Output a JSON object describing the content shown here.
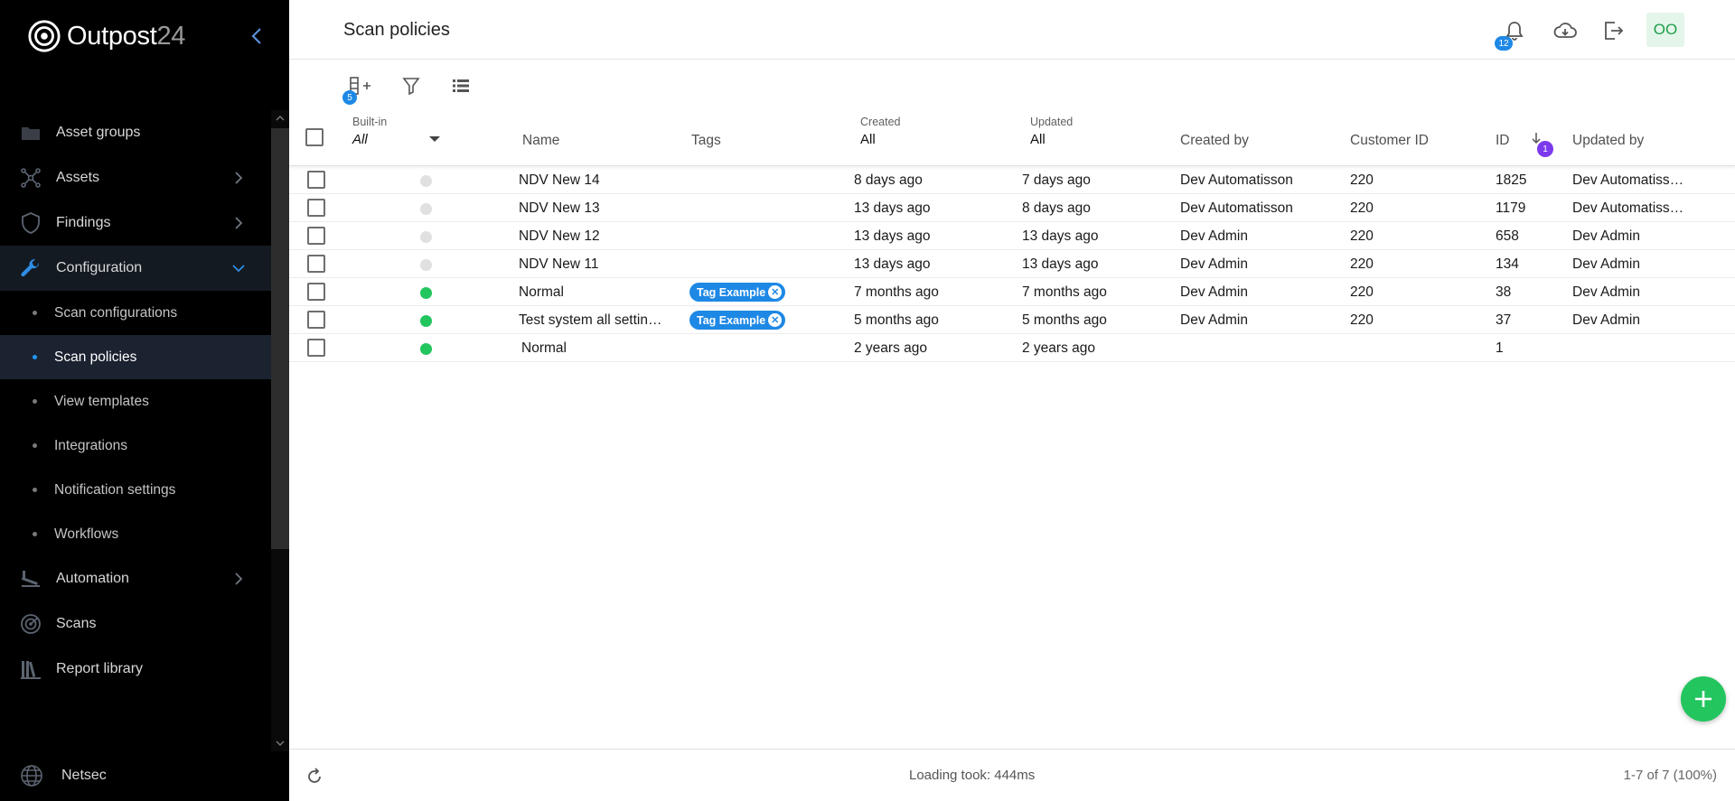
{
  "app": {
    "logo_name": "Outpost",
    "logo_num": "24"
  },
  "sidebar": {
    "items": [
      {
        "label": "Asset groups",
        "icon": "folder-icon"
      },
      {
        "label": "Assets",
        "icon": "network-icon"
      },
      {
        "label": "Findings",
        "icon": "shield-icon"
      },
      {
        "label": "Configuration",
        "icon": "wrench-icon"
      },
      {
        "label": "Automation",
        "icon": "automation-icon"
      },
      {
        "label": "Scans",
        "icon": "radar-icon"
      },
      {
        "label": "Report library",
        "icon": "library-icon"
      }
    ],
    "sub_items": [
      {
        "label": "Scan configurations"
      },
      {
        "label": "Scan policies"
      },
      {
        "label": "View templates"
      },
      {
        "label": "Integrations"
      },
      {
        "label": "Notification settings"
      },
      {
        "label": "Workflows"
      }
    ],
    "org_label": "Netsec"
  },
  "header": {
    "title": "Scan policies",
    "notification_count": "12",
    "avatar_initials": "OO"
  },
  "toolbar": {
    "columns_badge": "5"
  },
  "table": {
    "filters": {
      "builtin_label": "Built-in",
      "builtin_value": "All",
      "created_label": "Created",
      "created_value": "All",
      "updated_label": "Updated",
      "updated_value": "All"
    },
    "headers": {
      "name": "Name",
      "tags": "Tags",
      "created_by": "Created by",
      "customer_id": "Customer ID",
      "id": "ID",
      "id_sort_badge": "1",
      "updated_by": "Updated by"
    },
    "rows": [
      {
        "builtin": false,
        "name": "NDV New 14",
        "tag": "",
        "created": "8 days ago",
        "updated": "7 days ago",
        "created_by": "Dev Automatisson",
        "customer_id": "220",
        "id": "1825",
        "updated_by": "Dev Automatiss…"
      },
      {
        "builtin": false,
        "name": "NDV New 13",
        "tag": "",
        "created": "13 days ago",
        "updated": "8 days ago",
        "created_by": "Dev Automatisson",
        "customer_id": "220",
        "id": "1179",
        "updated_by": "Dev Automatiss…"
      },
      {
        "builtin": false,
        "name": "NDV New 12",
        "tag": "",
        "created": "13 days ago",
        "updated": "13 days ago",
        "created_by": "Dev Admin",
        "customer_id": "220",
        "id": "658",
        "updated_by": "Dev Admin"
      },
      {
        "builtin": false,
        "name": "NDV New 11",
        "tag": "",
        "created": "13 days ago",
        "updated": "13 days ago",
        "created_by": "Dev Admin",
        "customer_id": "220",
        "id": "134",
        "updated_by": "Dev Admin"
      },
      {
        "builtin": true,
        "name": "Normal",
        "tag": "Tag Example",
        "created": "7 months ago",
        "updated": "7 months ago",
        "created_by": "Dev Admin",
        "customer_id": "220",
        "id": "38",
        "updated_by": "Dev Admin"
      },
      {
        "builtin": true,
        "name": "Test system all settin…",
        "tag": "Tag Example",
        "created": "5 months ago",
        "updated": "5 months ago",
        "created_by": "Dev Admin",
        "customer_id": "220",
        "id": "37",
        "updated_by": "Dev Admin"
      },
      {
        "builtin": true,
        "name": "Normal",
        "tag": "",
        "created": "2 years ago",
        "updated": "2 years ago",
        "created_by": "",
        "customer_id": "",
        "id": "1",
        "updated_by": ""
      }
    ]
  },
  "footer": {
    "loading_text": "Loading took: 444ms",
    "pagination": "1-7 of 7 (100%)"
  },
  "colors": {
    "builtin_on": "#22c55e",
    "builtin_off": "#e0e0e0",
    "accent": "#1e88e5",
    "sort_badge": "#7c3aed"
  }
}
